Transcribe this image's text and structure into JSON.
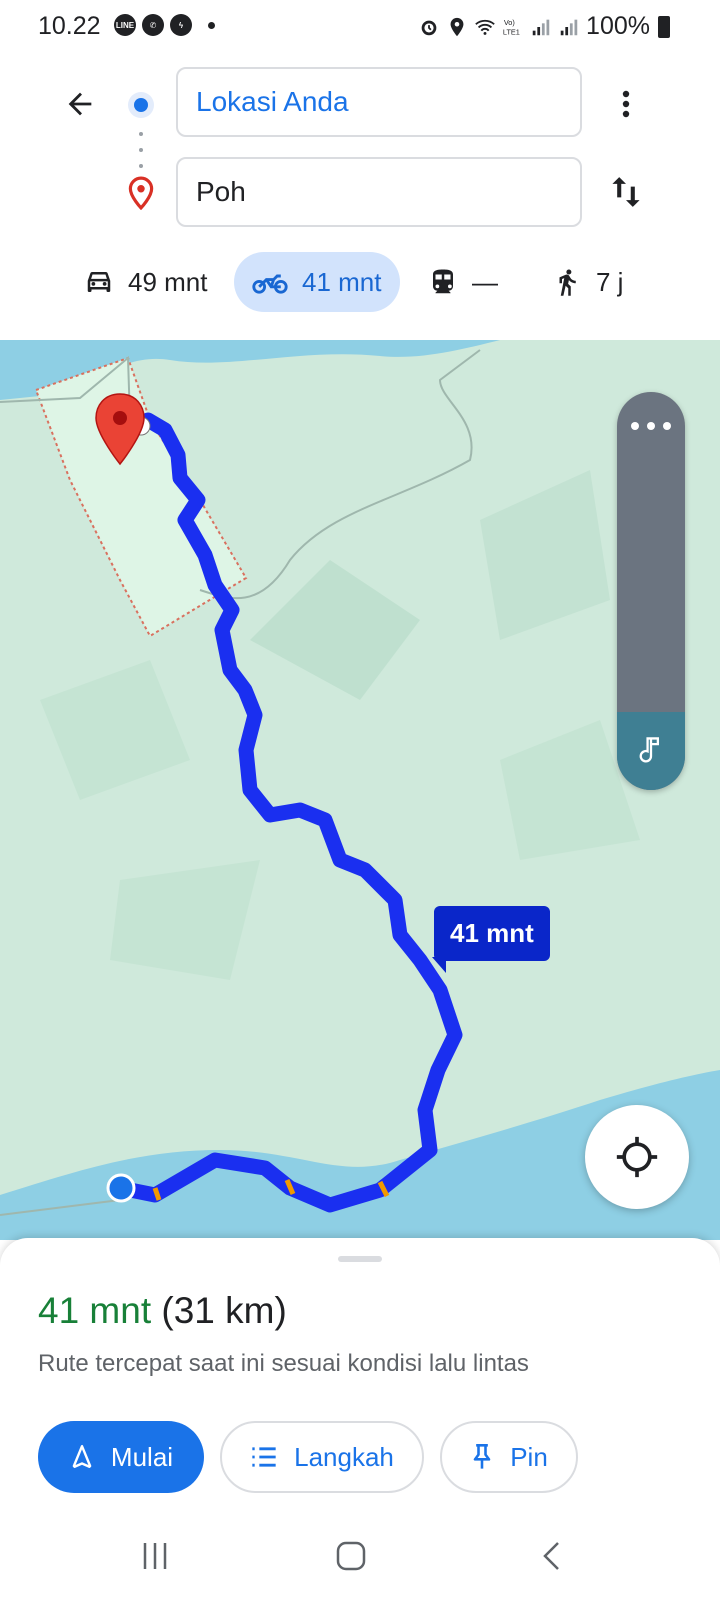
{
  "status_bar": {
    "time": "10.22",
    "battery": "100%",
    "notification_icons": [
      "line-icon",
      "whatsapp-icon",
      "messenger-icon",
      "more-dot"
    ],
    "system_icons": [
      "alarm-icon",
      "location-icon",
      "wifi-icon",
      "volte-lte-icon",
      "signal-icon",
      "signal-icon"
    ]
  },
  "directions": {
    "origin": "Lokasi Anda",
    "destination": "Poh"
  },
  "modes": [
    {
      "icon": "car-icon",
      "label": "49 mnt",
      "selected": false
    },
    {
      "icon": "motorcycle-icon",
      "label": "41 mnt",
      "selected": true
    },
    {
      "icon": "transit-icon",
      "label": "—",
      "selected": false
    },
    {
      "icon": "walk-icon",
      "label": "7 j",
      "selected": false
    }
  ],
  "map": {
    "route_eta_label": "41 mnt",
    "route_color": "#1a2ff0",
    "water_color": "#8ecfe4",
    "land_color": "#cfe9db"
  },
  "sheet": {
    "eta": "41 mnt",
    "distance": "(31 km)",
    "description": "Rute tercepat saat ini sesuai kondisi lalu lintas",
    "buttons": {
      "start": "Mulai",
      "steps": "Langkah",
      "pin": "Pin"
    }
  },
  "nav_bar": [
    "recents-icon",
    "home-icon",
    "back-icon"
  ],
  "colors": {
    "accent": "#1a73e8",
    "eta_green": "#188038",
    "selected_mode_bg": "#d2e3fc"
  }
}
